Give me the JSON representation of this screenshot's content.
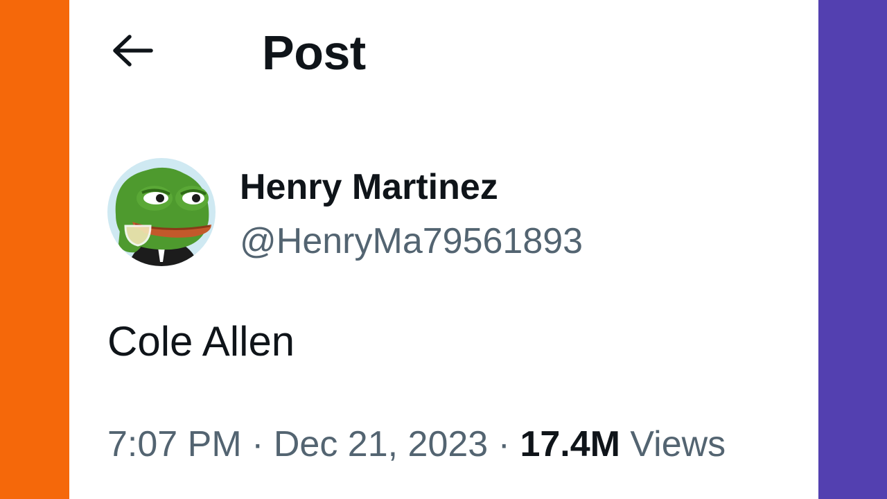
{
  "colors": {
    "left_bar": "#f5680a",
    "right_bar": "#5340b0",
    "text_primary": "#0f1419",
    "text_secondary": "#536471"
  },
  "header": {
    "back_icon": "arrow-left-icon",
    "title": "Post"
  },
  "author": {
    "avatar_icon": "frog-avatar",
    "display_name": "Henry Martinez",
    "handle": "@HenryMa79561893"
  },
  "post": {
    "text": "Cole Allen"
  },
  "meta": {
    "time": "7:07 PM",
    "separator": " · ",
    "date": "Dec 21, 2023",
    "views_count": "17.4M",
    "views_label": " Views"
  }
}
